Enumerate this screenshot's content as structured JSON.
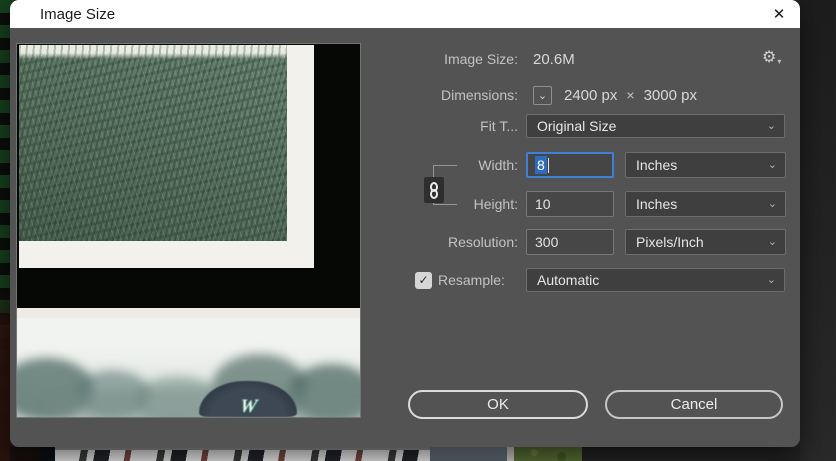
{
  "window": {
    "title": "Image Size"
  },
  "icons": {
    "close": "✕",
    "gear": "⚙",
    "gear_caret": "▾",
    "chevron_down": "⌄",
    "check": "✓"
  },
  "form": {
    "image_size": {
      "label": "Image Size:",
      "value": "20.6M"
    },
    "dimensions": {
      "label": "Dimensions:",
      "width": "2400 px",
      "times": "×",
      "height": "3000 px"
    },
    "fit_to": {
      "label": "Fit T...",
      "value": "Original Size"
    },
    "width": {
      "label": "Width:",
      "value": "8",
      "unit": "Inches"
    },
    "height": {
      "label": "Height:",
      "value": "10",
      "unit": "Inches"
    },
    "resolution": {
      "label": "Resolution:",
      "value": "300",
      "unit": "Pixels/Inch"
    },
    "resample": {
      "label": "Resample:",
      "checked": true,
      "value": "Automatic"
    }
  },
  "buttons": {
    "ok": "OK",
    "cancel": "Cancel"
  },
  "preview": {
    "cap_logo": "W"
  },
  "colors": {
    "dialog_bg": "#535353",
    "titlebar_bg": "#ffffff",
    "focus_blue": "#3f7fd6",
    "selection_blue": "#2e6bbd",
    "backdrop_green": "#16401e"
  }
}
